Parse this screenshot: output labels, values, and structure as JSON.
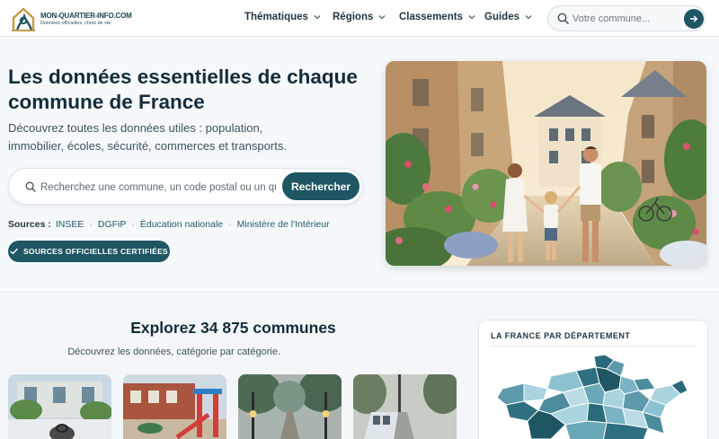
{
  "header": {
    "logo_name": "MON-QUARTIER-INFO.COM",
    "logo_tagline": "Données officielles, choix de vie.",
    "nav": [
      "Thématiques",
      "Régions",
      "Classements",
      "Guides"
    ],
    "search_placeholder": "Votre commune..."
  },
  "hero": {
    "title": "Les données essentielles de chaque commune de France",
    "subtitle": "Découvrez toutes les données utiles : population, immobilier, écoles, sécurité, commerces et transports.",
    "search_placeholder": "Recherchez une commune, un code postal ou un quartier",
    "search_button": "Rechercher",
    "sources_label": "Sources :",
    "sources": [
      "INSEE",
      "DGFiP",
      "Éducation nationale",
      "Ministère de l'Intérieur"
    ],
    "badge": "SOURCES OFFICIELLES CERTIFIÉES"
  },
  "explore": {
    "title": "Explorez 34 875 communes",
    "subtitle": "Découvrez les données, catégorie par catégorie."
  },
  "map_panel": {
    "title": "LA FRANCE PAR DÉPARTEMENT"
  },
  "colors": {
    "primary": "#1f5663",
    "text_dark": "#142c38",
    "map_dark": "#2a6a7a",
    "map_light": "#a8d3df"
  }
}
